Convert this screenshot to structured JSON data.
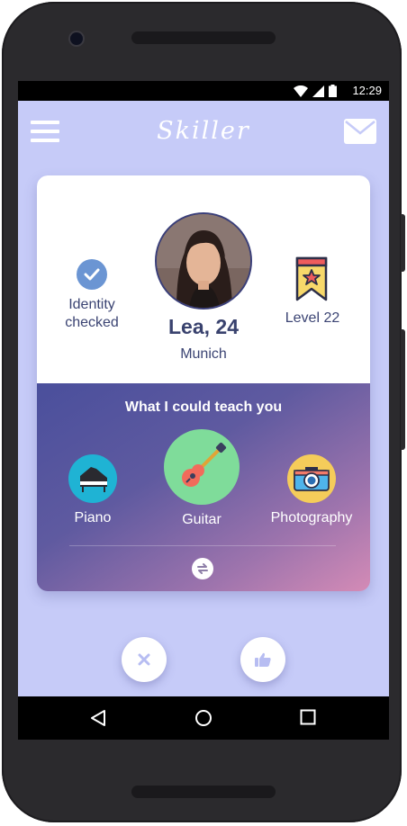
{
  "status_bar": {
    "time": "12:29"
  },
  "app": {
    "title": "Skiller"
  },
  "profile": {
    "identity_label": "Identity checked",
    "name_age": "Lea, 24",
    "city": "Munich",
    "level_label": "Level 22"
  },
  "teach": {
    "title": "What I could teach you",
    "skills": [
      {
        "label": "Piano",
        "icon": "piano-icon",
        "color": "#1fb3d4"
      },
      {
        "label": "Guitar",
        "icon": "guitar-icon",
        "color": "#7fdc9a"
      },
      {
        "label": "Photography",
        "icon": "camera-icon",
        "color": "#f5cc5a"
      }
    ]
  },
  "actions": {
    "reject": "close-icon",
    "like": "thumbs-up-icon"
  },
  "colors": {
    "background": "#c6cbf8",
    "text_dark": "#39426e",
    "verified": "#6b95d3",
    "gradient_start": "#4a4f9c",
    "gradient_end": "#d48bb6"
  }
}
